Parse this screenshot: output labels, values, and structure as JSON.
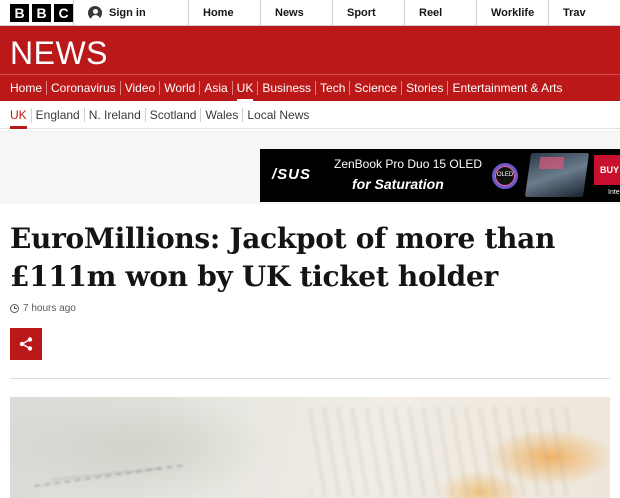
{
  "topbar": {
    "logo_letters": [
      "B",
      "B",
      "C"
    ],
    "signin_label": "Sign in",
    "nav": [
      "Home",
      "News",
      "Sport",
      "Reel",
      "Worklife",
      "Trav"
    ]
  },
  "header": {
    "title": "NEWS"
  },
  "section_nav": [
    "Home",
    "Coronavirus",
    "Video",
    "World",
    "Asia",
    "UK",
    "Business",
    "Tech",
    "Science",
    "Stories",
    "Entertainment & Arts"
  ],
  "sub_nav": [
    "UK",
    "England",
    "N. Ireland",
    "Scotland",
    "Wales",
    "Local News"
  ],
  "ad": {
    "brand": "/SUS",
    "line1": "ZenBook Pro Duo 15 OLED",
    "line2": "for Saturation",
    "badge": "OLED",
    "buy": "BUY N",
    "intel": "Inte"
  },
  "article": {
    "headline": "EuroMillions: Jackpot of more than £111m won by UK ticket holder",
    "timestamp": "7 hours ago"
  },
  "colors": {
    "brand_red": "#bb1919"
  }
}
